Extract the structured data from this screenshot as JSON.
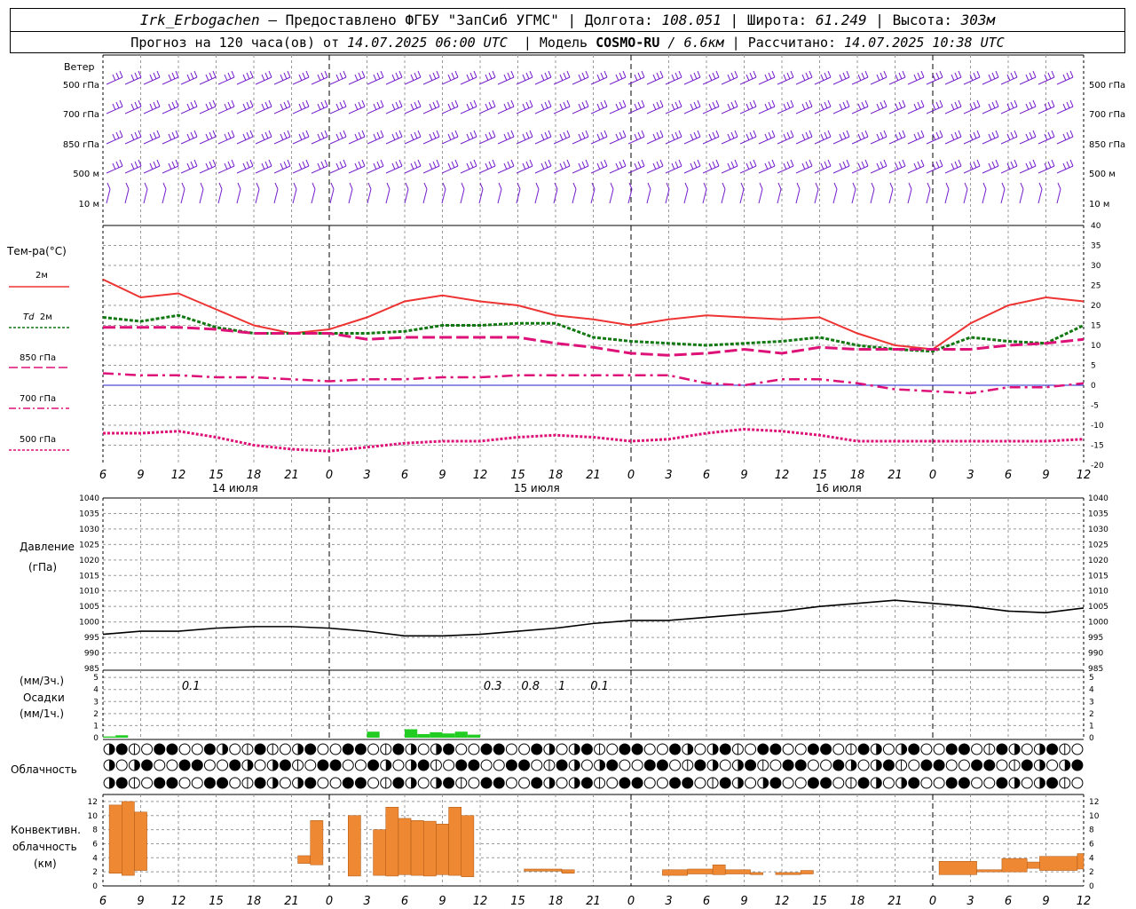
{
  "header": {
    "station": "Irk_Erbogachen",
    "provider": "– Предоставлено ФГБУ \"ЗапСиб УГМС\" |",
    "lon_label": "Долгота:",
    "lon": "108.051",
    "lat_label": "| Широта:",
    "lat": "61.249",
    "alt_label": "| Высота:",
    "alt": "303м",
    "forecast_prefix": "Прогноз на 120 часа(ов) от",
    "forecast_time": "14.07.2025 06:00 UTC",
    "model_prefix": "| Модель",
    "model_name": "COSMO-RU",
    "model_res": "/ 6.6км",
    "calc_prefix": "| Рассчитано:",
    "calc_time": "14.07.2025 10:38 UTC"
  },
  "labels": {
    "wind": "Ветер",
    "temp": "Тем-ра(°C)",
    "t2m": "2м",
    "td2m_a": "Td",
    "td2m_b": "2м",
    "t850": "850 гПа",
    "t700": "700 гПа",
    "t500": "500 гПа",
    "pressure_a": "Давление",
    "pressure_b": "(гПа)",
    "precip_a": "(мм/3ч.)",
    "precip_b": "Осадки",
    "precip_c": "(мм/1ч.)",
    "cloud": "Облачность",
    "conv_a": "Конвективн.",
    "conv_b": "облачность",
    "conv_c": "(км)"
  },
  "wind_levels": [
    "500 гПа",
    "700 гПа",
    "850 гПа",
    "500 м",
    "10  м"
  ],
  "day_labels": [
    "14 июля",
    "15 июля",
    "16 июля"
  ],
  "hour_labels": [
    "6",
    "9",
    "12",
    "15",
    "18",
    "21",
    "0",
    "3",
    "6",
    "9",
    "12",
    "15",
    "18",
    "21",
    "0",
    "3",
    "6",
    "9",
    "12",
    "15",
    "18",
    "21",
    "0",
    "3",
    "6",
    "9",
    "12"
  ],
  "precip_values": [
    "0.1",
    "0.3",
    "0.8",
    "1",
    "0.1"
  ],
  "colors": {
    "t2m": "#ee3333",
    "td2m": "#117711",
    "t850": "#dd1177",
    "t700": "#dd1177",
    "t500": "#dd1177",
    "wind": "#7722cc",
    "pressure": "#000000",
    "precip": "#22cc22",
    "convective": "#ee8833",
    "grid": "#999999",
    "zero_line": "#2222cc"
  },
  "chart_data": [
    {
      "type": "line",
      "title": "Тем-ра(°C)",
      "x_hours": [
        6,
        9,
        12,
        15,
        18,
        21,
        24,
        27,
        30,
        33,
        36,
        39,
        42,
        45,
        48,
        51,
        54,
        57,
        60,
        63,
        66,
        69,
        72,
        75,
        78,
        81,
        84
      ],
      "ylim": [
        -20,
        40
      ],
      "series": [
        {
          "name": "2м",
          "values": [
            26.5,
            22,
            23,
            19,
            15,
            13,
            14,
            17,
            21,
            22.5,
            21,
            20,
            17.5,
            16.5,
            15,
            16.5,
            17.5,
            17,
            16.5,
            17,
            13,
            10,
            9,
            15.5,
            20,
            22,
            21
          ]
        },
        {
          "name": "Td 2м",
          "values": [
            17,
            16,
            17.5,
            14.5,
            13,
            13,
            13,
            13,
            13.5,
            15,
            15,
            15.5,
            15.5,
            12,
            11,
            10.5,
            10,
            10.5,
            11,
            12,
            10,
            9,
            8.5,
            12,
            11,
            10.5,
            15
          ]
        },
        {
          "name": "850 гПа",
          "values": [
            14.5,
            14.5,
            14.5,
            14,
            13,
            13,
            13,
            11.5,
            12,
            12,
            12,
            12,
            10.5,
            9.5,
            8,
            7.5,
            8,
            9,
            8,
            9.5,
            9,
            9,
            9,
            9,
            10,
            10.5,
            11.5
          ]
        },
        {
          "name": "700 гПа",
          "values": [
            3,
            2.5,
            2.5,
            2,
            2,
            1.5,
            1,
            1.5,
            1.5,
            2,
            2,
            2.5,
            2.5,
            2.5,
            2.5,
            2.5,
            0.5,
            0,
            1.5,
            1.5,
            0.5,
            -1,
            -1.5,
            -2,
            -0.5,
            -0.5,
            0.5
          ]
        },
        {
          "name": "500 гПа",
          "values": [
            -12,
            -12,
            -11.5,
            -13,
            -15,
            -16,
            -16.5,
            -15.5,
            -14.5,
            -14,
            -14,
            -13,
            -12.5,
            -13,
            -14,
            -13.5,
            -12,
            -11,
            -11.5,
            -12.5,
            -14,
            -14,
            -14,
            -14,
            -14,
            -14,
            -13.5
          ]
        }
      ]
    },
    {
      "type": "line",
      "title": "Давление (гПа)",
      "x_hours": [
        6,
        9,
        12,
        15,
        18,
        21,
        24,
        27,
        30,
        33,
        36,
        39,
        42,
        45,
        48,
        51,
        54,
        57,
        60,
        63,
        66,
        69,
        72,
        75,
        78,
        81,
        84
      ],
      "ylim": [
        985,
        1040
      ],
      "series": [
        {
          "name": "Давление",
          "values": [
            996,
            997,
            997,
            998,
            998.5,
            998.5,
            998,
            997,
            995.5,
            995.5,
            996,
            997,
            998,
            999.5,
            1000.5,
            1000.5,
            1001.5,
            1002.5,
            1003.5,
            1005,
            1006,
            1007,
            1006,
            1005,
            1003.5,
            1003,
            1004.5
          ]
        }
      ]
    },
    {
      "type": "bar",
      "title": "Осадки",
      "ylim": [
        0,
        5
      ],
      "bars": [
        {
          "x": 6.5,
          "value": 0.1
        },
        {
          "x": 7.5,
          "value": 0.2
        },
        {
          "x": 27.5,
          "value": 0.5
        },
        {
          "x": 30.5,
          "value": 0.7
        },
        {
          "x": 31.5,
          "value": 0.3
        },
        {
          "x": 32.5,
          "value": 0.45
        },
        {
          "x": 33.5,
          "value": 0.35
        },
        {
          "x": 34.5,
          "value": 0.5
        },
        {
          "x": 35.5,
          "value": 0.25
        }
      ]
    },
    {
      "type": "bar",
      "title": "Конвективн. облачность (км)",
      "ylim": [
        0,
        13
      ],
      "bars": [
        {
          "x0": 6.5,
          "x1": 7.5,
          "lo": 1.8,
          "hi": 11.5
        },
        {
          "x0": 7.5,
          "x1": 8.5,
          "lo": 1.5,
          "hi": 12
        },
        {
          "x0": 8.5,
          "x1": 9.5,
          "lo": 2.2,
          "hi": 10.5
        },
        {
          "x0": 21.5,
          "x1": 22.5,
          "lo": 3.2,
          "hi": 4.3
        },
        {
          "x0": 22.5,
          "x1": 23.5,
          "lo": 3,
          "hi": 9.3
        },
        {
          "x0": 25.5,
          "x1": 26.5,
          "lo": 1.4,
          "hi": 10
        },
        {
          "x0": 27.5,
          "x1": 28.5,
          "lo": 1.5,
          "hi": 8
        },
        {
          "x0": 28.5,
          "x1": 29.5,
          "lo": 1.4,
          "hi": 11.2
        },
        {
          "x0": 29.5,
          "x1": 30.5,
          "lo": 1.6,
          "hi": 9.6
        },
        {
          "x0": 30.5,
          "x1": 31.5,
          "lo": 1.5,
          "hi": 9.3
        },
        {
          "x0": 31.5,
          "x1": 32.5,
          "lo": 1.4,
          "hi": 9.2
        },
        {
          "x0": 32.5,
          "x1": 33.5,
          "lo": 1.6,
          "hi": 8.8
        },
        {
          "x0": 33.5,
          "x1": 34.5,
          "lo": 1.5,
          "hi": 11.2
        },
        {
          "x0": 34.5,
          "x1": 35.5,
          "lo": 1.3,
          "hi": 10
        },
        {
          "x0": 39.5,
          "x1": 42.5,
          "lo": 2.1,
          "hi": 2.4
        },
        {
          "x0": 42.5,
          "x1": 43.5,
          "lo": 1.8,
          "hi": 2.3
        },
        {
          "x0": 50.5,
          "x1": 52.5,
          "lo": 1.5,
          "hi": 2.3
        },
        {
          "x0": 52.5,
          "x1": 54.5,
          "lo": 1.7,
          "hi": 2.4
        },
        {
          "x0": 54.5,
          "x1": 55.5,
          "lo": 1.6,
          "hi": 3
        },
        {
          "x0": 55.5,
          "x1": 57.5,
          "lo": 1.7,
          "hi": 2.3
        },
        {
          "x0": 57.5,
          "x1": 58.5,
          "lo": 1.6,
          "hi": 1.9
        },
        {
          "x0": 59.5,
          "x1": 61.5,
          "lo": 1.6,
          "hi": 1.9
        },
        {
          "x0": 61.5,
          "x1": 62.5,
          "lo": 1.7,
          "hi": 2.2
        },
        {
          "x0": 72.5,
          "x1": 75.5,
          "lo": 1.6,
          "hi": 3.5
        },
        {
          "x0": 75.5,
          "x1": 77.5,
          "lo": 2,
          "hi": 2.3
        },
        {
          "x0": 77.5,
          "x1": 79.5,
          "lo": 2,
          "hi": 3.9
        },
        {
          "x0": 79.5,
          "x1": 80.5,
          "lo": 2.5,
          "hi": 3.4
        },
        {
          "x0": 80.5,
          "x1": 83.5,
          "lo": 2.2,
          "hi": 4.2
        },
        {
          "x0": 83.5,
          "x1": 84,
          "lo": 2.4,
          "hi": 4.6
        }
      ]
    }
  ]
}
